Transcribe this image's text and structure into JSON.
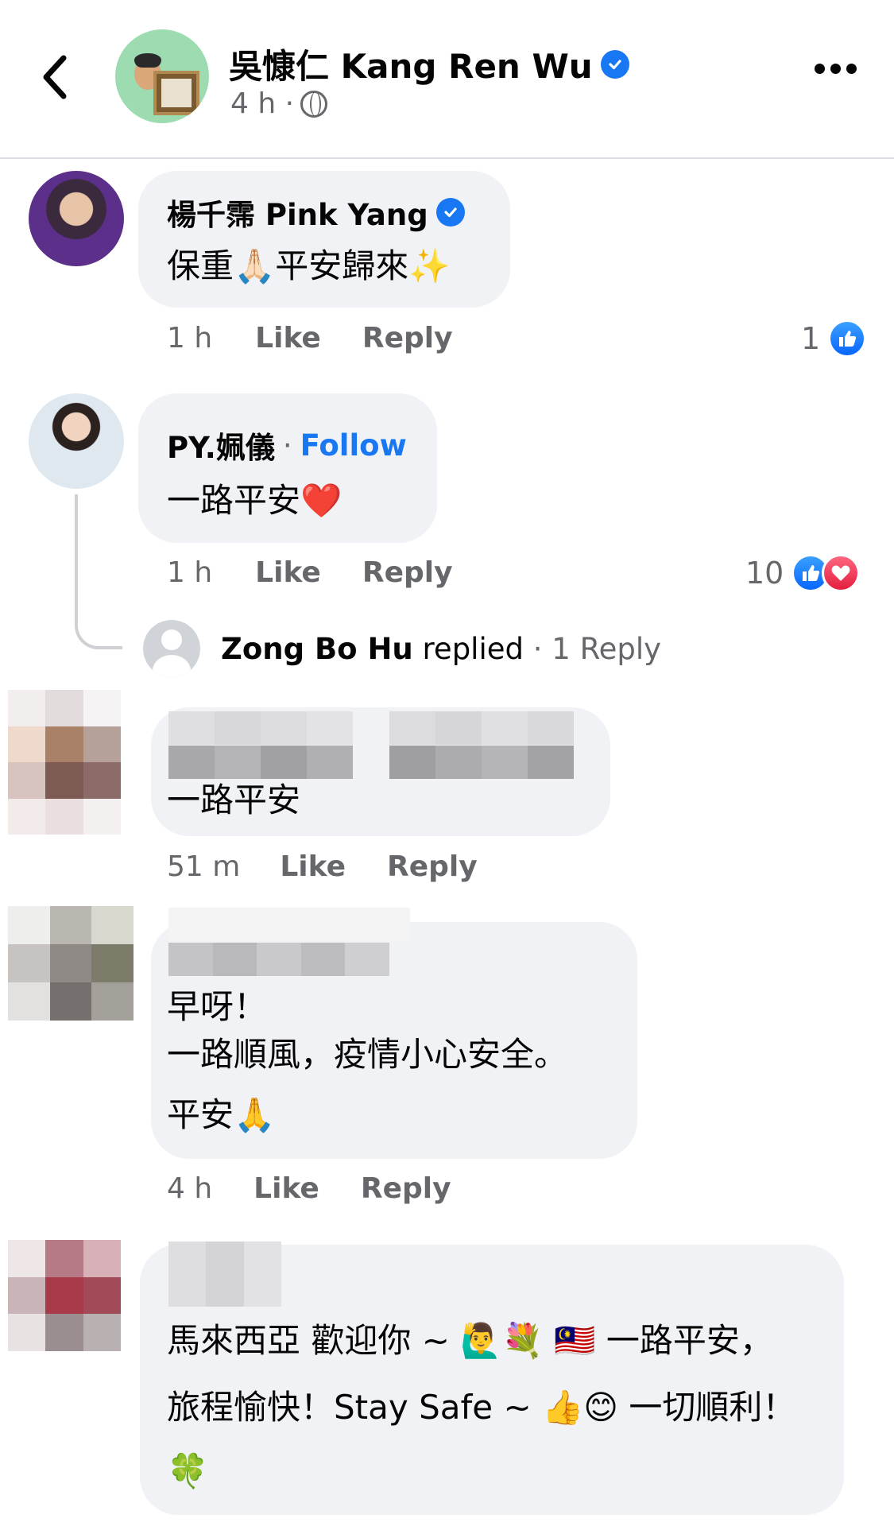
{
  "header": {
    "page_name": "吳慷仁 Kang Ren Wu",
    "post_time": "4 h ·"
  },
  "comments": [
    {
      "author": "楊千霈 Pink Yang",
      "text": "保重🙏🏻平安歸來✨",
      "time": "1 h",
      "like": "Like",
      "reply": "Reply",
      "reaction_count": "1"
    },
    {
      "author": "PY.姵儀",
      "follow_sep": "·",
      "follow": "Follow",
      "text": "一路平安❤️",
      "time": "1 h",
      "like": "Like",
      "reply": "Reply",
      "reaction_count": "10"
    },
    {
      "text": "一路平安",
      "time": "51 m",
      "like": "Like",
      "reply": "Reply"
    },
    {
      "line1": "早呀！",
      "line2": "一路順風，疫情小心安全。",
      "line3": "平安🙏",
      "time": "4 h",
      "like": "Like",
      "reply": "Reply"
    },
    {
      "line1": "馬來西亞 歡迎你 ~ 🙋‍♂️💐 🇲🇾 一路平安，",
      "line2": "旅程愉快！Stay Safe ~ 👍😊 一切順利！",
      "line3": "🍀"
    }
  ],
  "reply_summary": {
    "name": "Zong Bo Hu",
    "replied": "replied",
    "count": "· 1 Reply"
  },
  "colors": {
    "accent": "#1877f2",
    "bubble": "#f0f2f5",
    "muted": "#65676b"
  },
  "icons": [
    "back-chevron-icon",
    "verified-badge-icon",
    "globe-icon",
    "more-dots-icon",
    "like-reaction-icon",
    "love-reaction-icon"
  ]
}
